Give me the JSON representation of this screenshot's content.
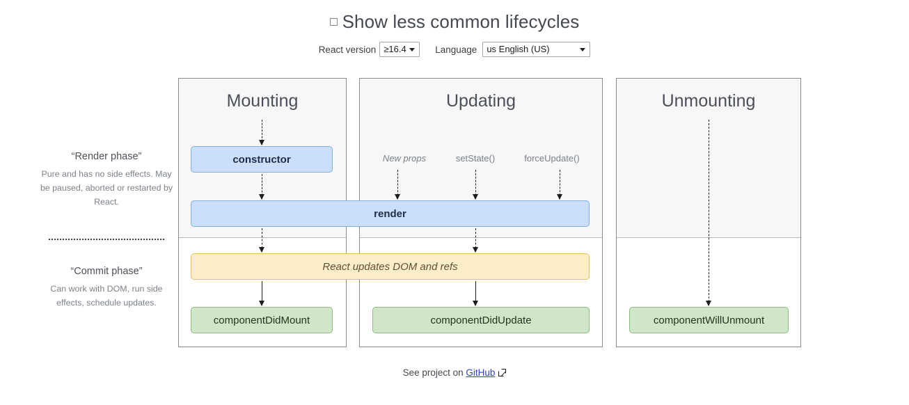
{
  "header": {
    "checkbox_label": "Show less common lifecycles",
    "checkbox_checked": false,
    "version_label": "React version",
    "version_value": "≥16.4",
    "language_label": "Language",
    "language_value": "us English (US)"
  },
  "phases": {
    "render": {
      "title": "“Render phase”",
      "description": "Pure and has no side effects. May be paused, aborted or restarted by React."
    },
    "commit": {
      "title": "“Commit phase”",
      "description": "Can work with DOM, run side effects, schedule updates."
    }
  },
  "columns": [
    {
      "id": "mounting",
      "title": "Mounting"
    },
    {
      "id": "updating",
      "title": "Updating"
    },
    {
      "id": "unmounting",
      "title": "Unmounting"
    }
  ],
  "triggers": [
    {
      "id": "new-props",
      "label": "New props",
      "italic": true
    },
    {
      "id": "set-state",
      "label": "setState()",
      "italic": false
    },
    {
      "id": "force-update",
      "label": "forceUpdate()",
      "italic": false
    }
  ],
  "boxes": {
    "constructor": "constructor",
    "render": "render",
    "updates_dom": "React updates DOM and refs",
    "component_did_mount": "componentDidMount",
    "component_did_update": "componentDidUpdate",
    "component_will_unmount": "componentWillUnmount"
  },
  "footer": {
    "text": "See project on",
    "link_label": "GitHub",
    "link_icon": "external-link-icon"
  },
  "colors": {
    "render_phase_box": "#cbdffc",
    "render_phase_border": "#84aee0",
    "commit_dom_box": "#fdeec9",
    "commit_dom_border": "#e3c169",
    "commit_method_box": "#cfe6c8",
    "commit_method_border": "#8cbd82",
    "column_header_bg": "#f7f7f7",
    "link": "#2b44c7"
  }
}
